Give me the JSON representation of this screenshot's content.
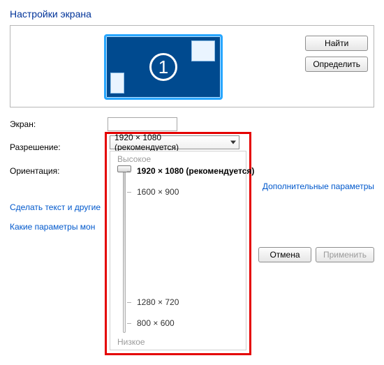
{
  "title": "Настройки экрана",
  "monitor_number": "1",
  "buttons": {
    "find": "Найти",
    "identify": "Определить",
    "cancel": "Отмена",
    "apply": "Применить"
  },
  "labels": {
    "screen": "Экран:",
    "resolution": "Разрешение:",
    "orientation": "Ориентация:"
  },
  "resolution_combo": "1920 × 1080 (рекомендуется)",
  "dropdown": {
    "high": "Высокое",
    "low": "Низкое",
    "options": [
      "1920 × 1080 (рекомендуется)",
      "1600 × 900",
      "1280 × 720",
      "800 × 600"
    ]
  },
  "links": {
    "text_size": "Сделать текст и другие",
    "which_params": "Какие параметры мон",
    "advanced": "Дополнительные параметры"
  }
}
